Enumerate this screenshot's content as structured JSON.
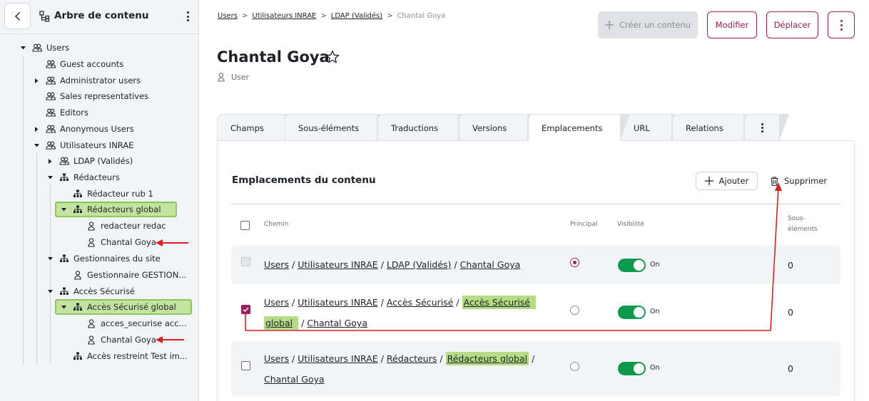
{
  "sidebar": {
    "title": "Arbre de contenu",
    "tree": [
      {
        "label": "Users"
      },
      {
        "label": "Guest accounts"
      },
      {
        "label": "Administrator users"
      },
      {
        "label": "Sales representatives"
      },
      {
        "label": "Editors"
      },
      {
        "label": "Anonymous Users"
      },
      {
        "label": "Utilisateurs INRAE"
      },
      {
        "label": "LDAP (Validés)"
      },
      {
        "label": "Rédacteurs"
      },
      {
        "label": "Rédacteur rub 1"
      },
      {
        "label": "Rédacteurs global"
      },
      {
        "label": "redacteur redac"
      },
      {
        "label": "Chantal Goya"
      },
      {
        "label": "Gestionnaires du site"
      },
      {
        "label": "Gestionnaire GESTION..."
      },
      {
        "label": "Accès Sécurisé"
      },
      {
        "label": "Accès Sécurisé global"
      },
      {
        "label": "acces_securise acc..."
      },
      {
        "label": "Chantal Goya"
      },
      {
        "label": "Accès restreint Test im..."
      }
    ]
  },
  "breadcrumb": {
    "items": [
      "Users",
      "Utilisateurs INRAE",
      "LDAP (Validés)"
    ],
    "separator": ">",
    "current": "Chantal Goya"
  },
  "toolbar": {
    "create_label": "Créer un contenu",
    "edit_label": "Modifier",
    "move_label": "Déplacer"
  },
  "page": {
    "title": "Chantal Goya",
    "type": "User"
  },
  "tabs": [
    "Champs",
    "Sous-éléments",
    "Traductions",
    "Versions",
    "Emplacements",
    "URL",
    "Relations"
  ],
  "locations": {
    "title": "Emplacements du contenu",
    "add_label": "Ajouter",
    "delete_label": "Supprimer",
    "headers": {
      "path": "Chemin",
      "main": "Principal",
      "visibility": "Visibilité",
      "sub_line1": "Sous-",
      "sub_line2": "éléments"
    },
    "rows": [
      {
        "path": [
          "Users",
          "Utilisateurs INRAE",
          "LDAP (Validés)",
          "Chantal Goya"
        ],
        "main": true,
        "visibility": "On",
        "count": "0"
      },
      {
        "path": [
          "Users",
          "Utilisateurs INRAE",
          "Accès Sécurisé",
          "Accès Sécurisé",
          "global",
          "Chantal Goya"
        ],
        "main": false,
        "visibility": "On",
        "count": "0"
      },
      {
        "path": [
          "Users",
          "Utilisateurs INRAE",
          "Rédacteurs",
          "Rédacteurs global",
          "Chantal Goya"
        ],
        "main": false,
        "visibility": "On",
        "count": "0"
      }
    ],
    "path_separator": "/"
  },
  "colors": {
    "accent": "#9e1d5e",
    "toggle_on": "#0c9b4c",
    "highlight": "#b5dd85",
    "annotation": "#e02020"
  }
}
